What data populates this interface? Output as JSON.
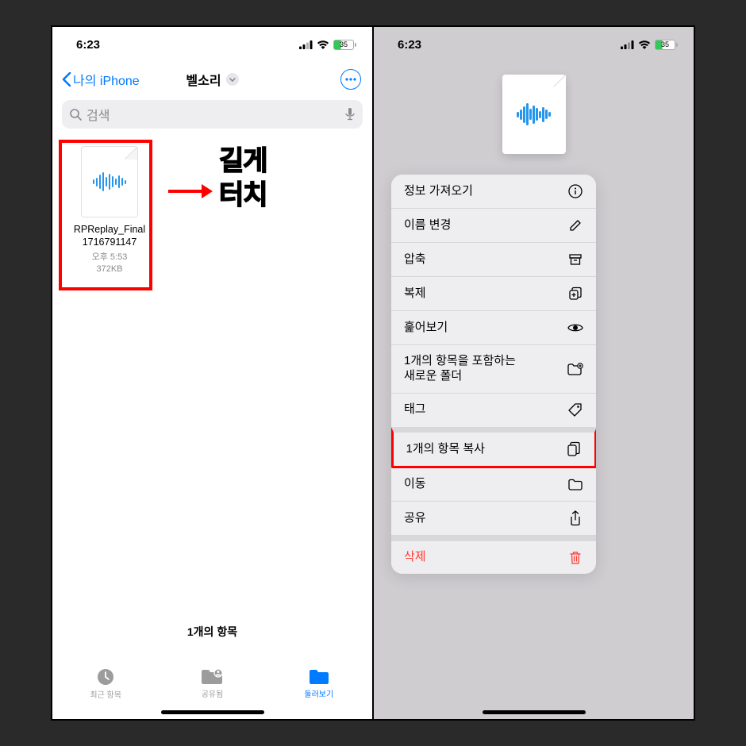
{
  "status": {
    "time": "6:23",
    "battery_text": "35"
  },
  "nav": {
    "back_label": "나의 iPhone",
    "title": "벨소리"
  },
  "search": {
    "placeholder": "검색"
  },
  "file": {
    "name_line1": "RPReplay_Final",
    "name_line2": "1716791147",
    "time": "오후 5:53",
    "size": "372KB"
  },
  "annotation": {
    "line1": "길게",
    "line2": "터치"
  },
  "footer": {
    "count": "1개의 항목"
  },
  "tabs": {
    "recent": "최근 항목",
    "shared": "공유됨",
    "browse": "둘러보기"
  },
  "menu": {
    "get_info": "정보 가져오기",
    "rename": "이름 변경",
    "compress": "압축",
    "duplicate": "복제",
    "quick_look": "훑어보기",
    "new_folder": "1개의 항목을 포함하는\n새로운 폴더",
    "tags": "태그",
    "copy": "1개의 항목 복사",
    "move": "이동",
    "share": "공유",
    "delete": "삭제"
  }
}
